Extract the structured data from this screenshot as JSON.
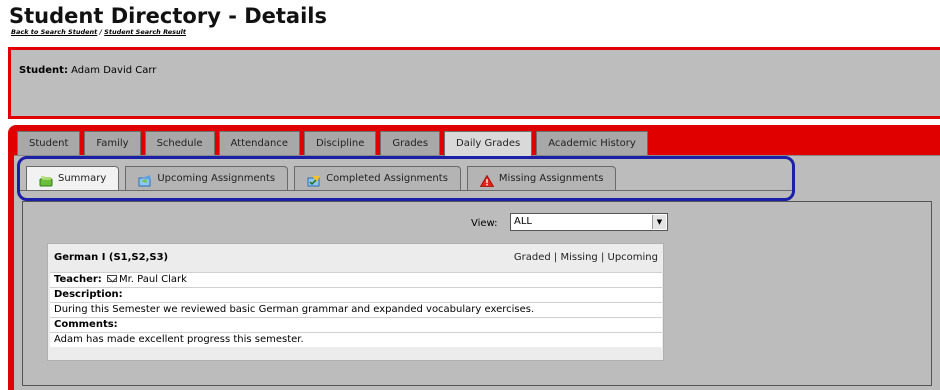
{
  "page": {
    "title": "Student Directory - Details",
    "breadcrumb": [
      "Back to Search Student",
      "Student Search Result"
    ],
    "breadcrumb_separator": " / "
  },
  "student": {
    "label": "Student:",
    "name": "Adam David Carr"
  },
  "main_tabs": [
    {
      "label": "Student",
      "active": false
    },
    {
      "label": "Family",
      "active": false
    },
    {
      "label": "Schedule",
      "active": false
    },
    {
      "label": "Attendance",
      "active": false
    },
    {
      "label": "Discipline",
      "active": false
    },
    {
      "label": "Grades",
      "active": false
    },
    {
      "label": "Daily Grades",
      "active": true
    },
    {
      "label": "Academic History",
      "active": false
    }
  ],
  "sub_tabs": [
    {
      "label": "Summary",
      "icon": "summary-icon",
      "active": true
    },
    {
      "label": "Upcoming Assignments",
      "icon": "upcoming-assignments-icon",
      "active": false
    },
    {
      "label": "Completed Assignments",
      "icon": "completed-assignments-icon",
      "active": false
    },
    {
      "label": "Missing Assignments",
      "icon": "warning-icon",
      "active": false
    }
  ],
  "view": {
    "label": "View:",
    "selected": "ALL"
  },
  "course": {
    "title": "German I (S1,S2,S3)",
    "links": [
      "Graded",
      "Missing",
      "Upcoming"
    ],
    "link_separator": " | ",
    "teacher_label": "Teacher:",
    "teacher_name": "Mr. Paul Clark",
    "description_label": "Description:",
    "description": "During this Semester we reviewed basic German grammar and expanded vocabulary exercises.",
    "comments_label": "Comments:",
    "comments": "Adam has made excellent progress this semester."
  },
  "colors": {
    "highlight_red": "#e00000",
    "highlight_blue": "#1c1fa8",
    "panel_gray": "#bcbcbc"
  }
}
